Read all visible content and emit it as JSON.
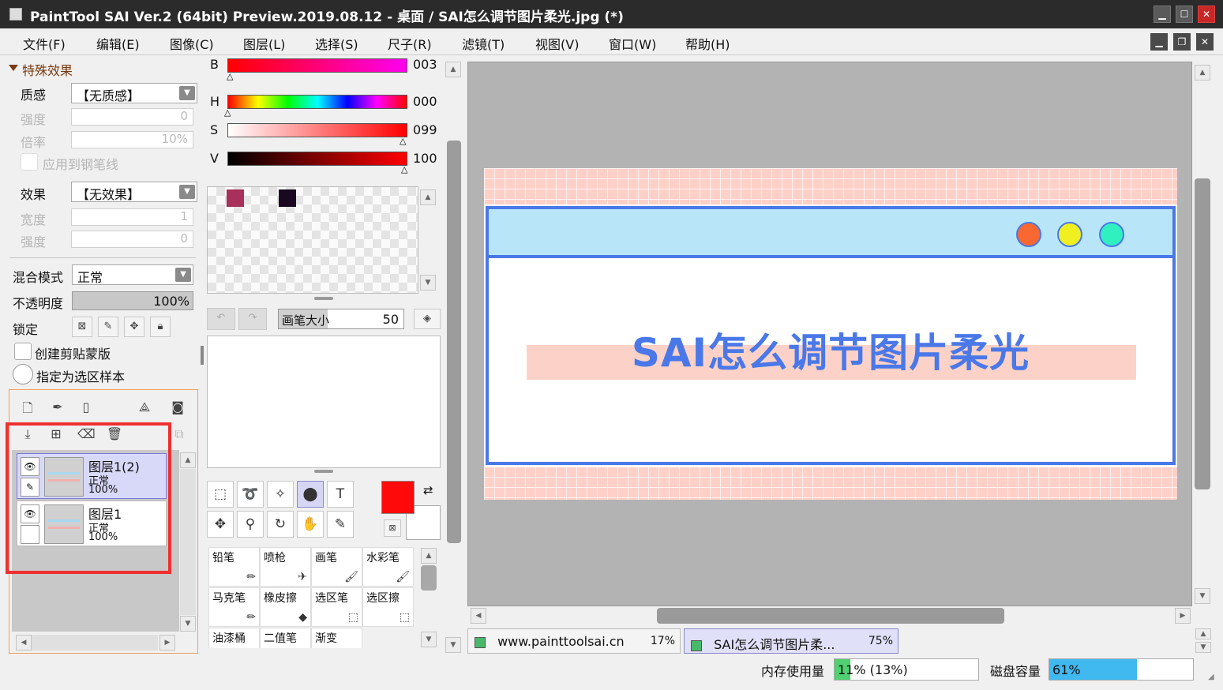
{
  "window": {
    "title": "PaintTool SAI Ver.2 (64bit) Preview.2019.08.12 - 桌面 / SAI怎么调节图片柔光.jpg (*)",
    "min": "▁",
    "max": "☐",
    "close": "✕"
  },
  "menu": [
    "文件(F)",
    "编辑(E)",
    "图像(C)",
    "图层(L)",
    "选择(S)",
    "尺子(R)",
    "滤镜(T)",
    "视图(V)",
    "窗口(W)",
    "帮助(H)"
  ],
  "mdi": {
    "min": "▁",
    "restore": "❐",
    "close": "✕"
  },
  "effects": {
    "header": "特殊效果",
    "texture_label": "质感",
    "texture_value": "【无质感】",
    "strength_label": "强度",
    "strength_value": "0",
    "scale_label": "倍率",
    "scale_value": "10%",
    "apply_pen_label": "应用到钢笔线",
    "effect_label": "效果",
    "effect_value": "【无效果】",
    "width_label": "宽度",
    "width_value": "1",
    "strength2_label": "强度",
    "strength2_value": "0"
  },
  "layer_props": {
    "blend_label": "混合模式",
    "blend_value": "正常",
    "opacity_label": "不透明度",
    "opacity_value": "100%",
    "opacity_fraction": 1.0,
    "lock_label": "锁定",
    "clip_label": "创建剪贴蒙版",
    "sample_label": "指定为选区样本"
  },
  "layers": [
    {
      "name": "图层1(2)",
      "mode": "正常",
      "opacity": "100%",
      "selected": true
    },
    {
      "name": "图层1",
      "mode": "正常",
      "opacity": "100%",
      "selected": false
    }
  ],
  "color": {
    "b_label": "B",
    "b_value": "003",
    "h_label": "H",
    "h_value": "000",
    "s_label": "S",
    "s_value": "099",
    "v_label": "V",
    "v_value": "100",
    "swatches": [
      "#a8305a",
      "#1a0820"
    ],
    "fg": "#ff0a0a",
    "bg": "#ffffff"
  },
  "brush_size": {
    "label": "画笔大小",
    "value": "50"
  },
  "tools": [
    {
      "name": "rect-select-tool",
      "glyph": "⬚",
      "active": false
    },
    {
      "name": "lasso-tool",
      "glyph": "➰",
      "active": false
    },
    {
      "name": "magic-wand-tool",
      "glyph": "✧",
      "active": false
    },
    {
      "name": "select-pen-tool",
      "glyph": "⬤",
      "active": true
    },
    {
      "name": "text-tool",
      "glyph": "T",
      "active": false
    },
    {
      "name": "move-tool",
      "glyph": "✥",
      "active": false
    },
    {
      "name": "zoom-tool",
      "glyph": "⚲",
      "active": false
    },
    {
      "name": "rotate-tool",
      "glyph": "↻",
      "active": false
    },
    {
      "name": "hand-tool",
      "glyph": "✋",
      "active": false
    },
    {
      "name": "eyedropper-tool",
      "glyph": "✎",
      "active": false
    }
  ],
  "brushes": [
    "铅笔",
    "喷枪",
    "画笔",
    "水彩笔",
    "马克笔",
    "橡皮擦",
    "选区笔",
    "选区擦",
    "油漆桶",
    "二值笔",
    "渐变"
  ],
  "canvas": {
    "headline": "SAI怎么调节图片柔光",
    "dot_colors": [
      "#f86830",
      "#f0f020",
      "#30f0c0"
    ],
    "accent": "#4a78e8",
    "grid_color": "#ffd0c8"
  },
  "tabs": [
    {
      "label": "www.painttoolsai.cn",
      "zoom": "17%"
    },
    {
      "label": "SAI怎么调节图片柔...",
      "zoom": "75%"
    }
  ],
  "status": {
    "memory_label": "内存使用量",
    "memory_value": "11% (13%)",
    "memory_fraction": 0.11,
    "disk_label": "磁盘容量",
    "disk_value": "61%",
    "disk_fraction": 0.61
  }
}
